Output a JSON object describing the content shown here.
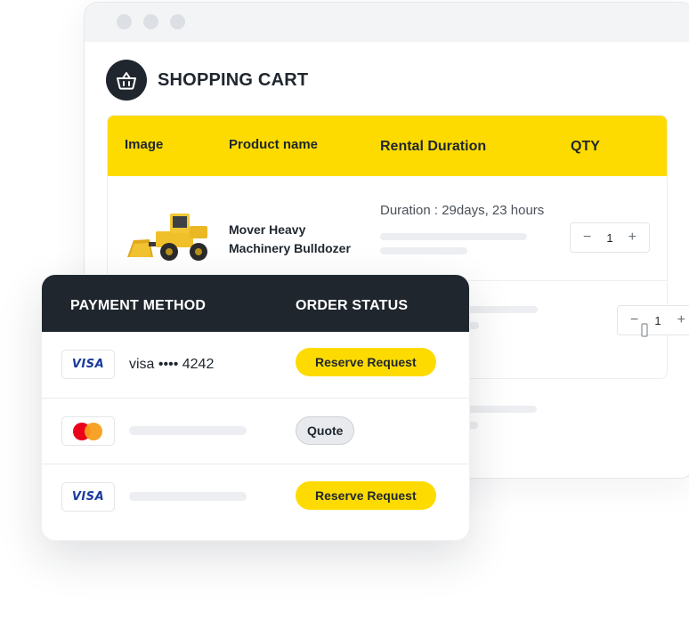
{
  "cart": {
    "title": "SHOPPING CART",
    "headers": {
      "image": "Image",
      "product_name": "Product name",
      "rental_duration": "Rental Duration",
      "qty": "QTY"
    },
    "items": [
      {
        "name_line1": "Mover Heavy",
        "name_line2": "Machinery Bulldozer",
        "duration": "Duration : 29days, 23 hours",
        "qty": "1"
      },
      {
        "qty": "1"
      }
    ],
    "qty_minus": "−",
    "qty_plus": "+"
  },
  "payment": {
    "headers": {
      "method": "PAYMENT METHOD",
      "status": "ORDER STATUS"
    },
    "rows": [
      {
        "card_brand": "VISA",
        "card_number": "visa •••• 4242",
        "status": "Reserve Request"
      },
      {
        "card_brand": "mastercard-icon",
        "card_number": "",
        "status": "Quote"
      },
      {
        "card_brand": "VISA",
        "card_number": "",
        "status": "Reserve Request"
      }
    ]
  },
  "colors": {
    "accent": "#fedb00",
    "dark": "#1f262e",
    "visa_blue": "#1a3a9c",
    "mc_red": "#eb001b",
    "mc_orange": "#f79e1b"
  }
}
